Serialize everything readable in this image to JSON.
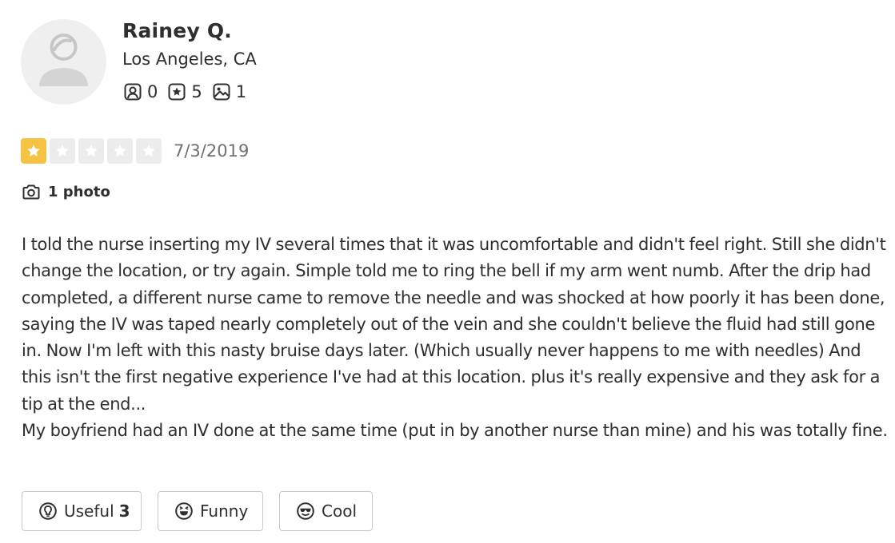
{
  "user": {
    "name": "Rainey Q.",
    "location": "Los Angeles, CA",
    "stats": {
      "friends": "0",
      "reviews": "5",
      "photos": "1"
    }
  },
  "review": {
    "rating": 1,
    "rating_max": 5,
    "date": "7/3/2019",
    "photo_link_label": "1 photo",
    "text": "I told the nurse inserting my IV several times that it was uncomfortable and didn't feel right. Still she didn't change the location, or try again. Simple told me to ring the bell if my arm went numb. After the drip had completed, a different nurse came to remove the needle and was shocked at how poorly it has been done, saying the IV was taped nearly completely out of the vein and she couldn't believe the fluid had still gone in. Now I'm left with this nasty bruise days later. (Which usually never happens to me with needles) And this isn't the first negative experience I've had at this location. plus it's really expensive and they ask for a tip at the end...\nMy boyfriend had an IV done at the same time (put in by another nurse than mine) and his was totally fine."
  },
  "reactions": {
    "useful_label": "Useful",
    "useful_count": "3",
    "funny_label": "Funny",
    "cool_label": "Cool"
  },
  "colors": {
    "star_filled": "#f5c243",
    "star_empty": "#ececec",
    "text": "#2d2e2f",
    "muted": "#6e7072",
    "border": "#c8c9ca"
  }
}
